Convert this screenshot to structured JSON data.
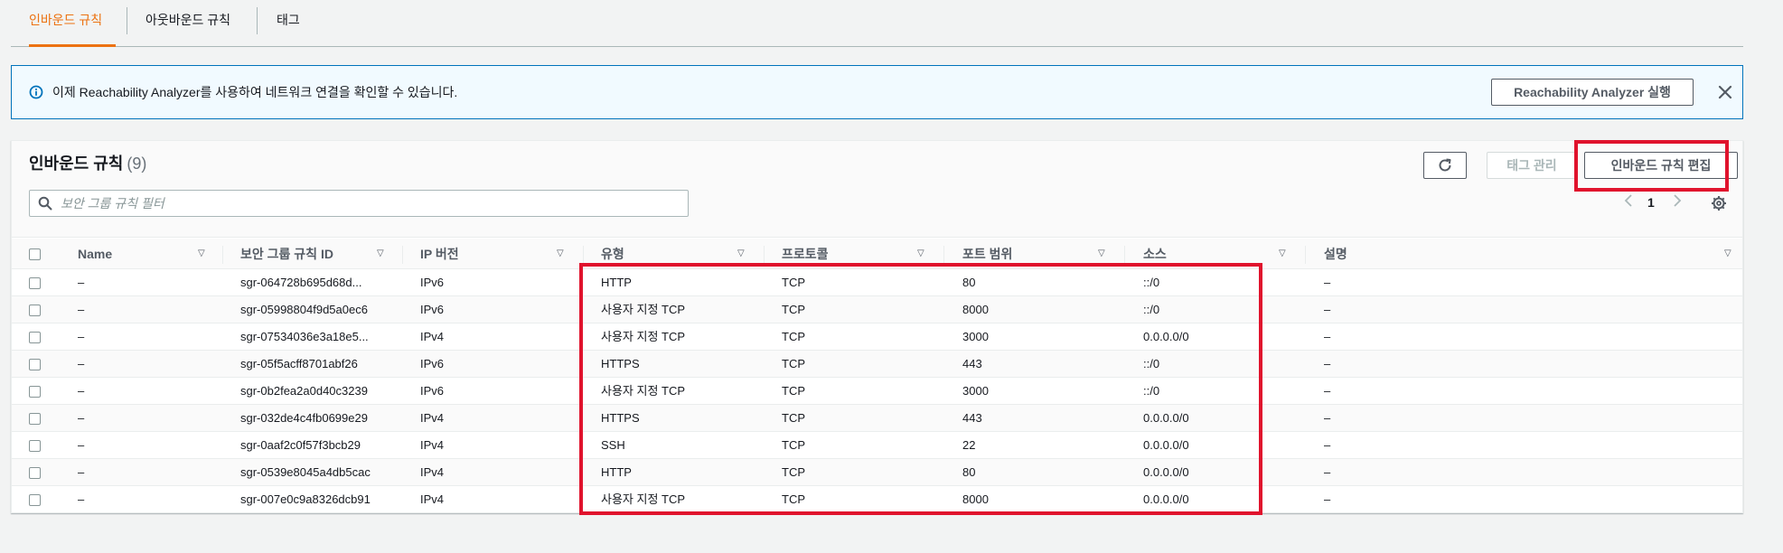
{
  "tabs": [
    {
      "label": "인바운드 규칙",
      "active": true
    },
    {
      "label": "아웃바운드 규칙",
      "active": false
    },
    {
      "label": "태그",
      "active": false
    }
  ],
  "banner": {
    "message": "이제 Reachability Analyzer를 사용하여 네트워크 연결을 확인할 수 있습니다.",
    "button_label": "Reachability Analyzer 실행",
    "icon": "info-icon"
  },
  "panel": {
    "title": "인바운드 규칙",
    "count": "(9)",
    "tag_button": "태그 관리",
    "edit_button": "인바운드 규칙 편집",
    "search_placeholder": "보안 그룹 규칙 필터",
    "page": "1"
  },
  "table": {
    "headers": {
      "name": "Name",
      "rule_id": "보안 그룹 규칙 ID",
      "ip_version": "IP 버전",
      "type": "유형",
      "protocol": "프로토콜",
      "port_range": "포트 범위",
      "source": "소스",
      "description": "설명"
    },
    "rows": [
      {
        "name": "–",
        "rule_id": "sgr-064728b695d68d...",
        "ip_version": "IPv6",
        "type": "HTTP",
        "protocol": "TCP",
        "port_range": "80",
        "source": "::/0",
        "description": "–"
      },
      {
        "name": "–",
        "rule_id": "sgr-05998804f9d5a0ec6",
        "ip_version": "IPv6",
        "type": "사용자 지정 TCP",
        "protocol": "TCP",
        "port_range": "8000",
        "source": "::/0",
        "description": "–"
      },
      {
        "name": "–",
        "rule_id": "sgr-07534036e3a18e5...",
        "ip_version": "IPv4",
        "type": "사용자 지정 TCP",
        "protocol": "TCP",
        "port_range": "3000",
        "source": "0.0.0.0/0",
        "description": "–"
      },
      {
        "name": "–",
        "rule_id": "sgr-05f5acff8701abf26",
        "ip_version": "IPv6",
        "type": "HTTPS",
        "protocol": "TCP",
        "port_range": "443",
        "source": "::/0",
        "description": "–"
      },
      {
        "name": "–",
        "rule_id": "sgr-0b2fea2a0d40c3239",
        "ip_version": "IPv6",
        "type": "사용자 지정 TCP",
        "protocol": "TCP",
        "port_range": "3000",
        "source": "::/0",
        "description": "–"
      },
      {
        "name": "–",
        "rule_id": "sgr-032de4c4fb0699e29",
        "ip_version": "IPv4",
        "type": "HTTPS",
        "protocol": "TCP",
        "port_range": "443",
        "source": "0.0.0.0/0",
        "description": "–"
      },
      {
        "name": "–",
        "rule_id": "sgr-0aaf2c0f57f3bcb29",
        "ip_version": "IPv4",
        "type": "SSH",
        "protocol": "TCP",
        "port_range": "22",
        "source": "0.0.0.0/0",
        "description": "–"
      },
      {
        "name": "–",
        "rule_id": "sgr-0539e8045a4db5cac",
        "ip_version": "IPv4",
        "type": "HTTP",
        "protocol": "TCP",
        "port_range": "80",
        "source": "0.0.0.0/0",
        "description": "–"
      },
      {
        "name": "–",
        "rule_id": "sgr-007e0c9a8326dcb91",
        "ip_version": "IPv4",
        "type": "사용자 지정 TCP",
        "protocol": "TCP",
        "port_range": "8000",
        "source": "0.0.0.0/0",
        "description": "–"
      }
    ]
  },
  "colors": {
    "accent": "#ec7211",
    "info_border": "#0073bb",
    "highlight": "#e0132d"
  }
}
